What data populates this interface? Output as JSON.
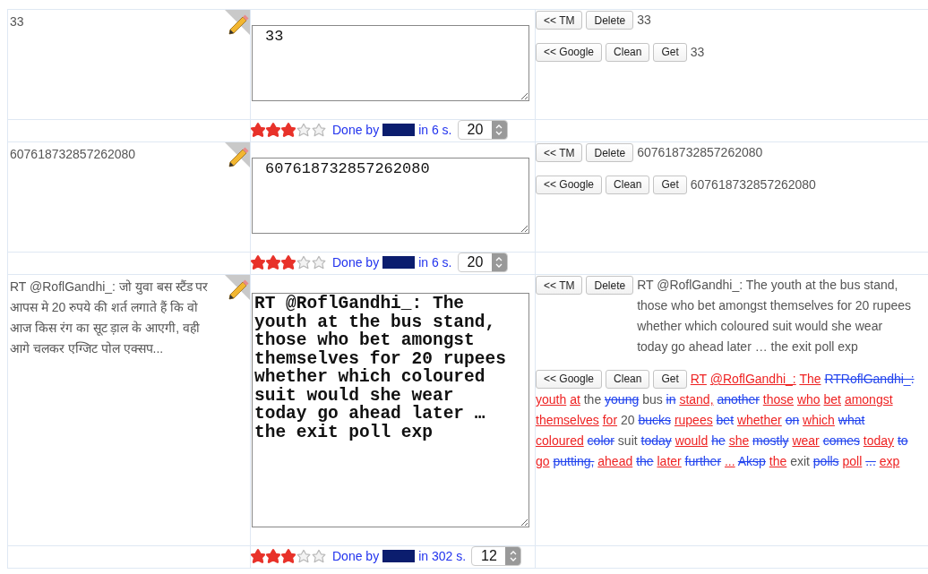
{
  "rows": [
    {
      "source": "33",
      "translation": "33",
      "tm_buttons": [
        "<< TM",
        "Delete"
      ],
      "tm_text": "33",
      "mt_buttons": [
        "<< Google",
        "Clean",
        "Get"
      ],
      "mt": [
        {
          "text": "33",
          "kind": "same"
        }
      ],
      "meta": {
        "stars": 3,
        "done_label": "Done by",
        "time": "in 6 s.",
        "score": "20"
      }
    },
    {
      "source": "607618732857262080",
      "translation": "607618732857262080",
      "tm_buttons": [
        "<< TM",
        "Delete"
      ],
      "tm_text": "607618732857262080",
      "mt_buttons": [
        "<< Google",
        "Clean",
        "Get"
      ],
      "mt": [
        {
          "text": "607618732857262080",
          "kind": "same"
        }
      ],
      "meta": {
        "stars": 3,
        "done_label": "Done by",
        "time": "in 6 s.",
        "score": "20"
      }
    },
    {
      "source": "RT @RoflGandhi_: जो युवा बस स्टैंड पर आपस मे 20 रुपये की शर्त लगाते हैं कि वो आज किस रंग का सूट ड़ाल के आएगी, वही आगे चलकर एग्जिट पोल एक्सप...",
      "translation": "RT @RoflGandhi_: The youth at the bus stand, those who bet amongst themselves for 20 rupees whether which coloured suit would she wear today go ahead later … the exit poll exp",
      "tm_buttons": [
        "<< TM",
        "Delete"
      ],
      "tm_text": "RT @RoflGandhi_: The youth at the bus stand, those who bet amongst themselves for 20 rupees whether which coloured suit would she wear today go ahead later … the exit poll exp",
      "mt_buttons": [
        "<< Google",
        "Clean",
        "Get"
      ],
      "mt": [
        {
          "text": "RT",
          "kind": "ins"
        },
        {
          "text": "@RoflGandhi_:",
          "kind": "ins"
        },
        {
          "text": "The",
          "kind": "ins"
        },
        {
          "text": "RTRoflGandhi_:",
          "kind": "del"
        },
        {
          "text": "youth",
          "kind": "ins"
        },
        {
          "text": "at",
          "kind": "ins"
        },
        {
          "text": "the",
          "kind": "same"
        },
        {
          "text": "young",
          "kind": "del"
        },
        {
          "text": "bus",
          "kind": "same"
        },
        {
          "text": "in",
          "kind": "del"
        },
        {
          "text": "stand,",
          "kind": "ins"
        },
        {
          "text": "another",
          "kind": "del"
        },
        {
          "text": "those",
          "kind": "ins"
        },
        {
          "text": "who",
          "kind": "ins"
        },
        {
          "text": "bet",
          "kind": "ins"
        },
        {
          "text": "amongst",
          "kind": "ins"
        },
        {
          "text": "themselves",
          "kind": "ins"
        },
        {
          "text": "for",
          "kind": "ins"
        },
        {
          "text": "20",
          "kind": "same"
        },
        {
          "text": "bucks",
          "kind": "del"
        },
        {
          "text": "rupees",
          "kind": "ins"
        },
        {
          "text": "bet",
          "kind": "del"
        },
        {
          "text": "whether",
          "kind": "ins"
        },
        {
          "text": "on",
          "kind": "del"
        },
        {
          "text": "which",
          "kind": "ins"
        },
        {
          "text": "what",
          "kind": "del"
        },
        {
          "text": "coloured",
          "kind": "ins"
        },
        {
          "text": "color",
          "kind": "del"
        },
        {
          "text": "suit",
          "kind": "same"
        },
        {
          "text": "today",
          "kind": "del"
        },
        {
          "text": "would",
          "kind": "ins"
        },
        {
          "text": "he",
          "kind": "del"
        },
        {
          "text": "she",
          "kind": "ins"
        },
        {
          "text": "mostly",
          "kind": "del"
        },
        {
          "text": "wear",
          "kind": "ins"
        },
        {
          "text": "comes",
          "kind": "del"
        },
        {
          "text": "today",
          "kind": "ins"
        },
        {
          "text": "to",
          "kind": "del"
        },
        {
          "text": "go",
          "kind": "ins"
        },
        {
          "text": "putting,",
          "kind": "del"
        },
        {
          "text": "ahead",
          "kind": "ins"
        },
        {
          "text": "the",
          "kind": "del"
        },
        {
          "text": "later",
          "kind": "ins"
        },
        {
          "text": "further",
          "kind": "del"
        },
        {
          "text": "...",
          "kind": "ins"
        },
        {
          "text": "Aksp",
          "kind": "del"
        },
        {
          "text": "the",
          "kind": "ins"
        },
        {
          "text": "exit",
          "kind": "same"
        },
        {
          "text": "polls",
          "kind": "del"
        },
        {
          "text": "poll",
          "kind": "ins"
        },
        {
          "text": "...",
          "kind": "del"
        },
        {
          "text": "exp",
          "kind": "ins"
        }
      ],
      "meta": {
        "stars": 3,
        "done_label": "Done by",
        "time": "in 302 s.",
        "score": "12"
      }
    }
  ]
}
